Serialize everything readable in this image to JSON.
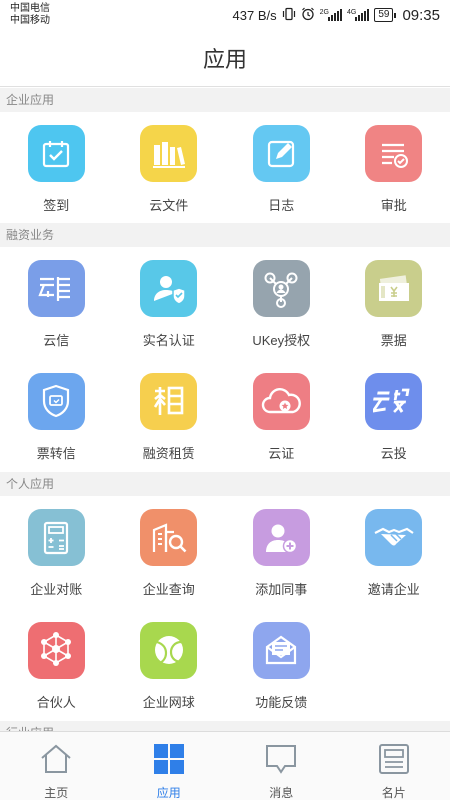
{
  "status_bar": {
    "carrier_1": "中国电信",
    "carrier_2": "中国移动",
    "net_speed": "437 B/s",
    "sim1_tag": "2G",
    "sim2_tag": "4G",
    "battery": "59",
    "time": "09:35"
  },
  "header": {
    "title": "应用"
  },
  "sections": [
    {
      "title": "企业应用",
      "apps": [
        {
          "label": "签到",
          "icon": "calendar-check-icon",
          "color": "#4ec6f0"
        },
        {
          "label": "云文件",
          "icon": "books-icon",
          "color": "#f5d54a"
        },
        {
          "label": "日志",
          "icon": "edit-note-icon",
          "color": "#64c8f2"
        },
        {
          "label": "审批",
          "icon": "approval-list-icon",
          "color": "#f08484"
        }
      ]
    },
    {
      "title": "融资业务",
      "apps": [
        {
          "label": "云信",
          "icon": "yunxin-logo-icon",
          "color": "#7a9ee8"
        },
        {
          "label": "实名认证",
          "icon": "user-shield-icon",
          "color": "#58c8e8"
        },
        {
          "label": "UKey授权",
          "icon": "network-user-icon",
          "color": "#96a4ae"
        },
        {
          "label": "票据",
          "icon": "bill-yen-icon",
          "color": "#c9ce8c"
        },
        {
          "label": "票转信",
          "icon": "shield-card-icon",
          "color": "#6ca6ee"
        },
        {
          "label": "融资租赁",
          "icon": "zu-character-icon",
          "color": "#f6cf4e"
        },
        {
          "label": "云证",
          "icon": "cloud-star-icon",
          "color": "#ee7e84"
        },
        {
          "label": "云投",
          "icon": "yuntou-logo-icon",
          "color": "#6e8eec"
        }
      ]
    },
    {
      "title": "个人应用",
      "apps": [
        {
          "label": "企业对账",
          "icon": "calculator-icon",
          "color": "#86c0d4"
        },
        {
          "label": "企业查询",
          "icon": "building-search-icon",
          "color": "#f0906a"
        },
        {
          "label": "添加同事",
          "icon": "add-user-icon",
          "color": "#c79ce0"
        },
        {
          "label": "邀请企业",
          "icon": "handshake-icon",
          "color": "#78b8ee"
        },
        {
          "label": "合伙人",
          "icon": "partner-network-icon",
          "color": "#ee6e72"
        },
        {
          "label": "企业网球",
          "icon": "tennis-ball-icon",
          "color": "#a8d84e"
        },
        {
          "label": "功能反馈",
          "icon": "mail-feedback-icon",
          "color": "#8ea6ee"
        }
      ]
    },
    {
      "title": "行业应用",
      "apps": []
    }
  ],
  "bottom_nav": [
    {
      "label": "主页",
      "icon": "home-icon",
      "active": false
    },
    {
      "label": "应用",
      "icon": "apps-grid-icon",
      "active": true
    },
    {
      "label": "消息",
      "icon": "message-icon",
      "active": false
    },
    {
      "label": "名片",
      "icon": "business-card-icon",
      "active": false
    }
  ],
  "colors": {
    "accent": "#2f7fe8",
    "section_bg": "#f2f2f2",
    "nav_inactive": "#8a96a0"
  }
}
